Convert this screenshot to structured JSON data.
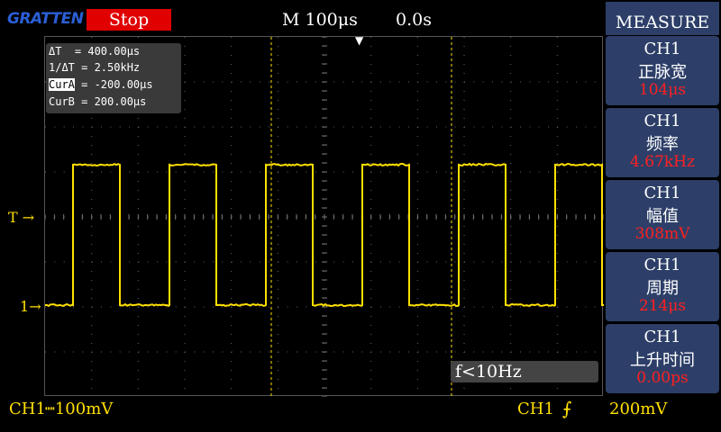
{
  "header": {
    "logo": "GRATTEN",
    "run_state": "Stop",
    "timebase": "M 100μs",
    "time_offset": "0.0s"
  },
  "cursor_readout": {
    "delta_t": "ΔT  = 400.00μs",
    "inv_delta_t": "1/ΔT = 2.50kHz",
    "cur_a_label": "CurA",
    "cur_a_value": " = -200.00μs",
    "cur_b": "CurB = 200.00μs"
  },
  "markers": {
    "trigger_level": "T",
    "channel": "1"
  },
  "freq_indicator": "f<10Hz",
  "status_bar": {
    "channel": "CH1",
    "scale": "┉100mV",
    "trigger_channel": "CH1",
    "trigger_level": "200mV"
  },
  "measure_menu": {
    "title": "MEASURE",
    "items": [
      {
        "channel": "CH1",
        "name": "正脉宽",
        "value": "104μs"
      },
      {
        "channel": "CH1",
        "name": "频率",
        "value": "4.67kHz"
      },
      {
        "channel": "CH1",
        "name": "幅值",
        "value": "308mV"
      },
      {
        "channel": "CH1",
        "name": "周期",
        "value": "214μs"
      },
      {
        "channel": "CH1",
        "name": "上升时间",
        "value": "0.00ps"
      }
    ]
  },
  "colors": {
    "trace": "#ffe000",
    "menu_bg": "#2d3f68",
    "value_red": "#ff2020",
    "stop_red": "#e00000"
  }
}
